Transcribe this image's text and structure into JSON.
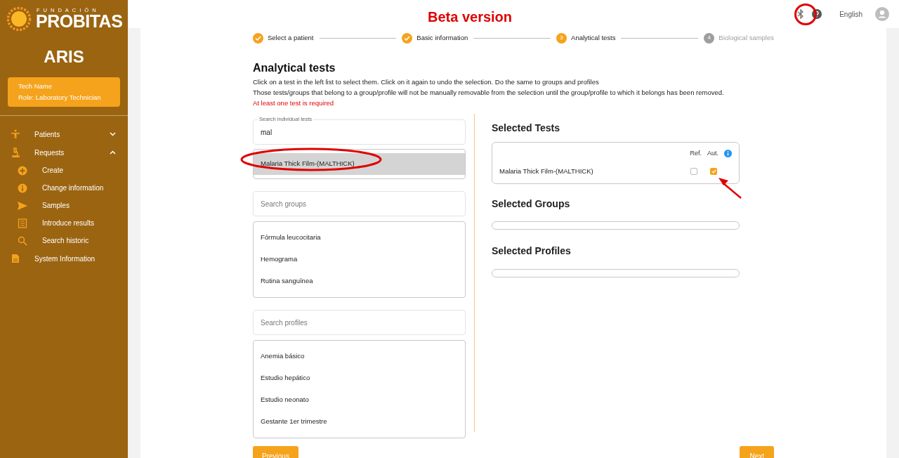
{
  "sidebar": {
    "logo_small": "FUNDACIÓN",
    "logo_big": "PROBITAS",
    "app_name": "ARIS",
    "user": {
      "name": "Tech Name",
      "role": "Role: Laboratory Technician"
    },
    "menu": [
      {
        "label": "Patients",
        "expanded": false
      },
      {
        "label": "Requests",
        "expanded": true,
        "children": [
          {
            "label": "Create"
          },
          {
            "label": "Change information"
          },
          {
            "label": "Samples"
          },
          {
            "label": "Introduce results"
          },
          {
            "label": "Search historic"
          }
        ]
      },
      {
        "label": "System Information"
      }
    ]
  },
  "header": {
    "banner": "Beta version",
    "language": "English"
  },
  "steps": [
    {
      "label": "Select a patient",
      "completed": true,
      "active": true
    },
    {
      "label": "Basic information",
      "completed": true,
      "active": true
    },
    {
      "label": "Analytical tests",
      "completed": false,
      "active": true,
      "number": "3"
    },
    {
      "label": "Biological samples",
      "completed": false,
      "active": false,
      "number": "4"
    }
  ],
  "page": {
    "title": "Analytical tests",
    "help": [
      "Click on a test in the left list to select them. Click on it again to undo the selection. Do the same to groups and profiles",
      "Those tests/groups that belong to a group/profile will not be manually removable from the selection until the group/profile to which it belongs has been removed."
    ],
    "error": "At least one test is required"
  },
  "tests_search": {
    "label": "Search individual tests",
    "value": "mal",
    "results": [
      {
        "label": "Malaria Thick Film-(MALTHICK)",
        "selected": true
      }
    ]
  },
  "groups_search": {
    "placeholder": "Search groups",
    "results": [
      {
        "label": "Fórmula leucocitaria",
        "selected": false
      },
      {
        "label": "Hemograma",
        "selected": false
      },
      {
        "label": "Rutina sanguínea",
        "selected": false
      }
    ]
  },
  "profiles_search": {
    "placeholder": "Search profiles",
    "results": [
      {
        "label": "Anemia básico",
        "selected": false
      },
      {
        "label": "Estudio hepático",
        "selected": false
      },
      {
        "label": "Estudio neonato",
        "selected": false
      },
      {
        "label": "Gestante 1er trimestre",
        "selected": false
      }
    ]
  },
  "selected_tests": {
    "title": "Selected Tests",
    "columns": [
      "Ref.",
      "Aut."
    ],
    "rows": [
      {
        "name": "Malaria Thick Film-(MALTHICK)",
        "ref": false,
        "aut": true
      }
    ]
  },
  "selected_groups": {
    "title": "Selected Groups"
  },
  "selected_profiles": {
    "title": "Selected Profiles"
  },
  "buttons": {
    "previous": "Previous",
    "next": "Next"
  }
}
